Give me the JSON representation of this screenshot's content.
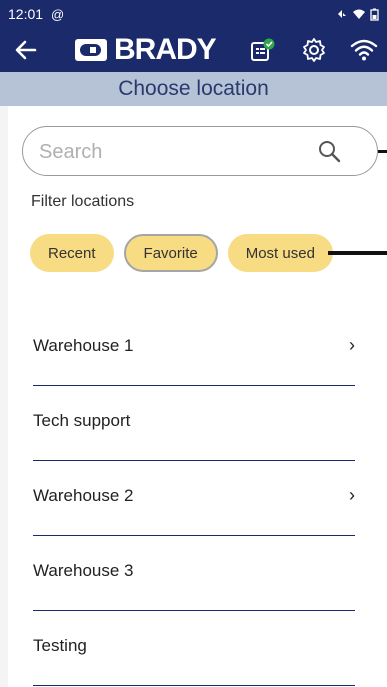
{
  "status_bar": {
    "time": "12:01",
    "at_icon": "@",
    "icons": [
      "signal-icon",
      "wifi-icon",
      "battery-icon"
    ]
  },
  "app_bar": {
    "logo_text": "BRADY",
    "icons": [
      "back-arrow-icon",
      "printer-status-icon",
      "gear-icon",
      "wifi-icon"
    ],
    "accent_color": "#1b2a6b",
    "status_ok_color": "#2ea84a"
  },
  "header": {
    "title": "Choose location"
  },
  "search": {
    "placeholder": "Search",
    "value": ""
  },
  "filter": {
    "label": "Filter locations",
    "chips": [
      {
        "label": "Recent",
        "selected": false
      },
      {
        "label": "Favorite",
        "selected": true
      },
      {
        "label": "Most used",
        "selected": false
      }
    ],
    "chip_color": "#f7dc83"
  },
  "locations": [
    {
      "label": "Warehouse 1",
      "has_children": true
    },
    {
      "label": "Tech support",
      "has_children": false
    },
    {
      "label": "Warehouse 2",
      "has_children": true
    },
    {
      "label": "Warehouse 3",
      "has_children": false
    },
    {
      "label": "Testing",
      "has_children": false
    }
  ],
  "chevron_glyph": "›"
}
